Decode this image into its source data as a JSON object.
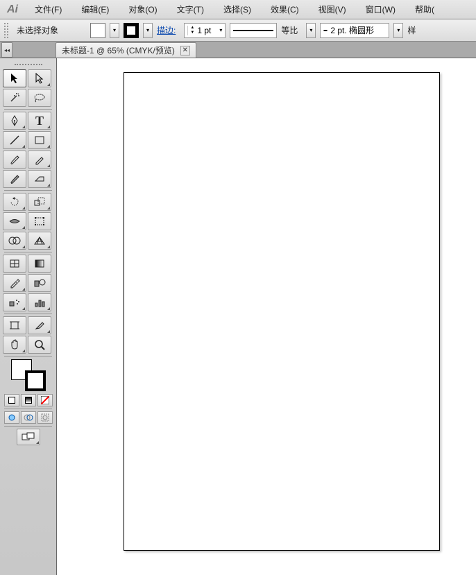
{
  "app_logo": "Ai",
  "menu": {
    "file": "文件(F)",
    "edit": "编辑(E)",
    "object": "对象(O)",
    "type": "文字(T)",
    "select": "选择(S)",
    "effect": "效果(C)",
    "view": "视图(V)",
    "window": "窗口(W)",
    "help": "帮助("
  },
  "control": {
    "no_selection": "未选择对象",
    "stroke_label": "描边:",
    "stroke_weight": "1 pt",
    "profile_label": "等比",
    "brush_label": "2 pt. 椭圆形",
    "style_label": "样"
  },
  "doc": {
    "tab_title": "未标题-1 @ 65% (CMYK/预览)"
  },
  "colors": {
    "fill": "#ffffff",
    "stroke": "#000000"
  }
}
